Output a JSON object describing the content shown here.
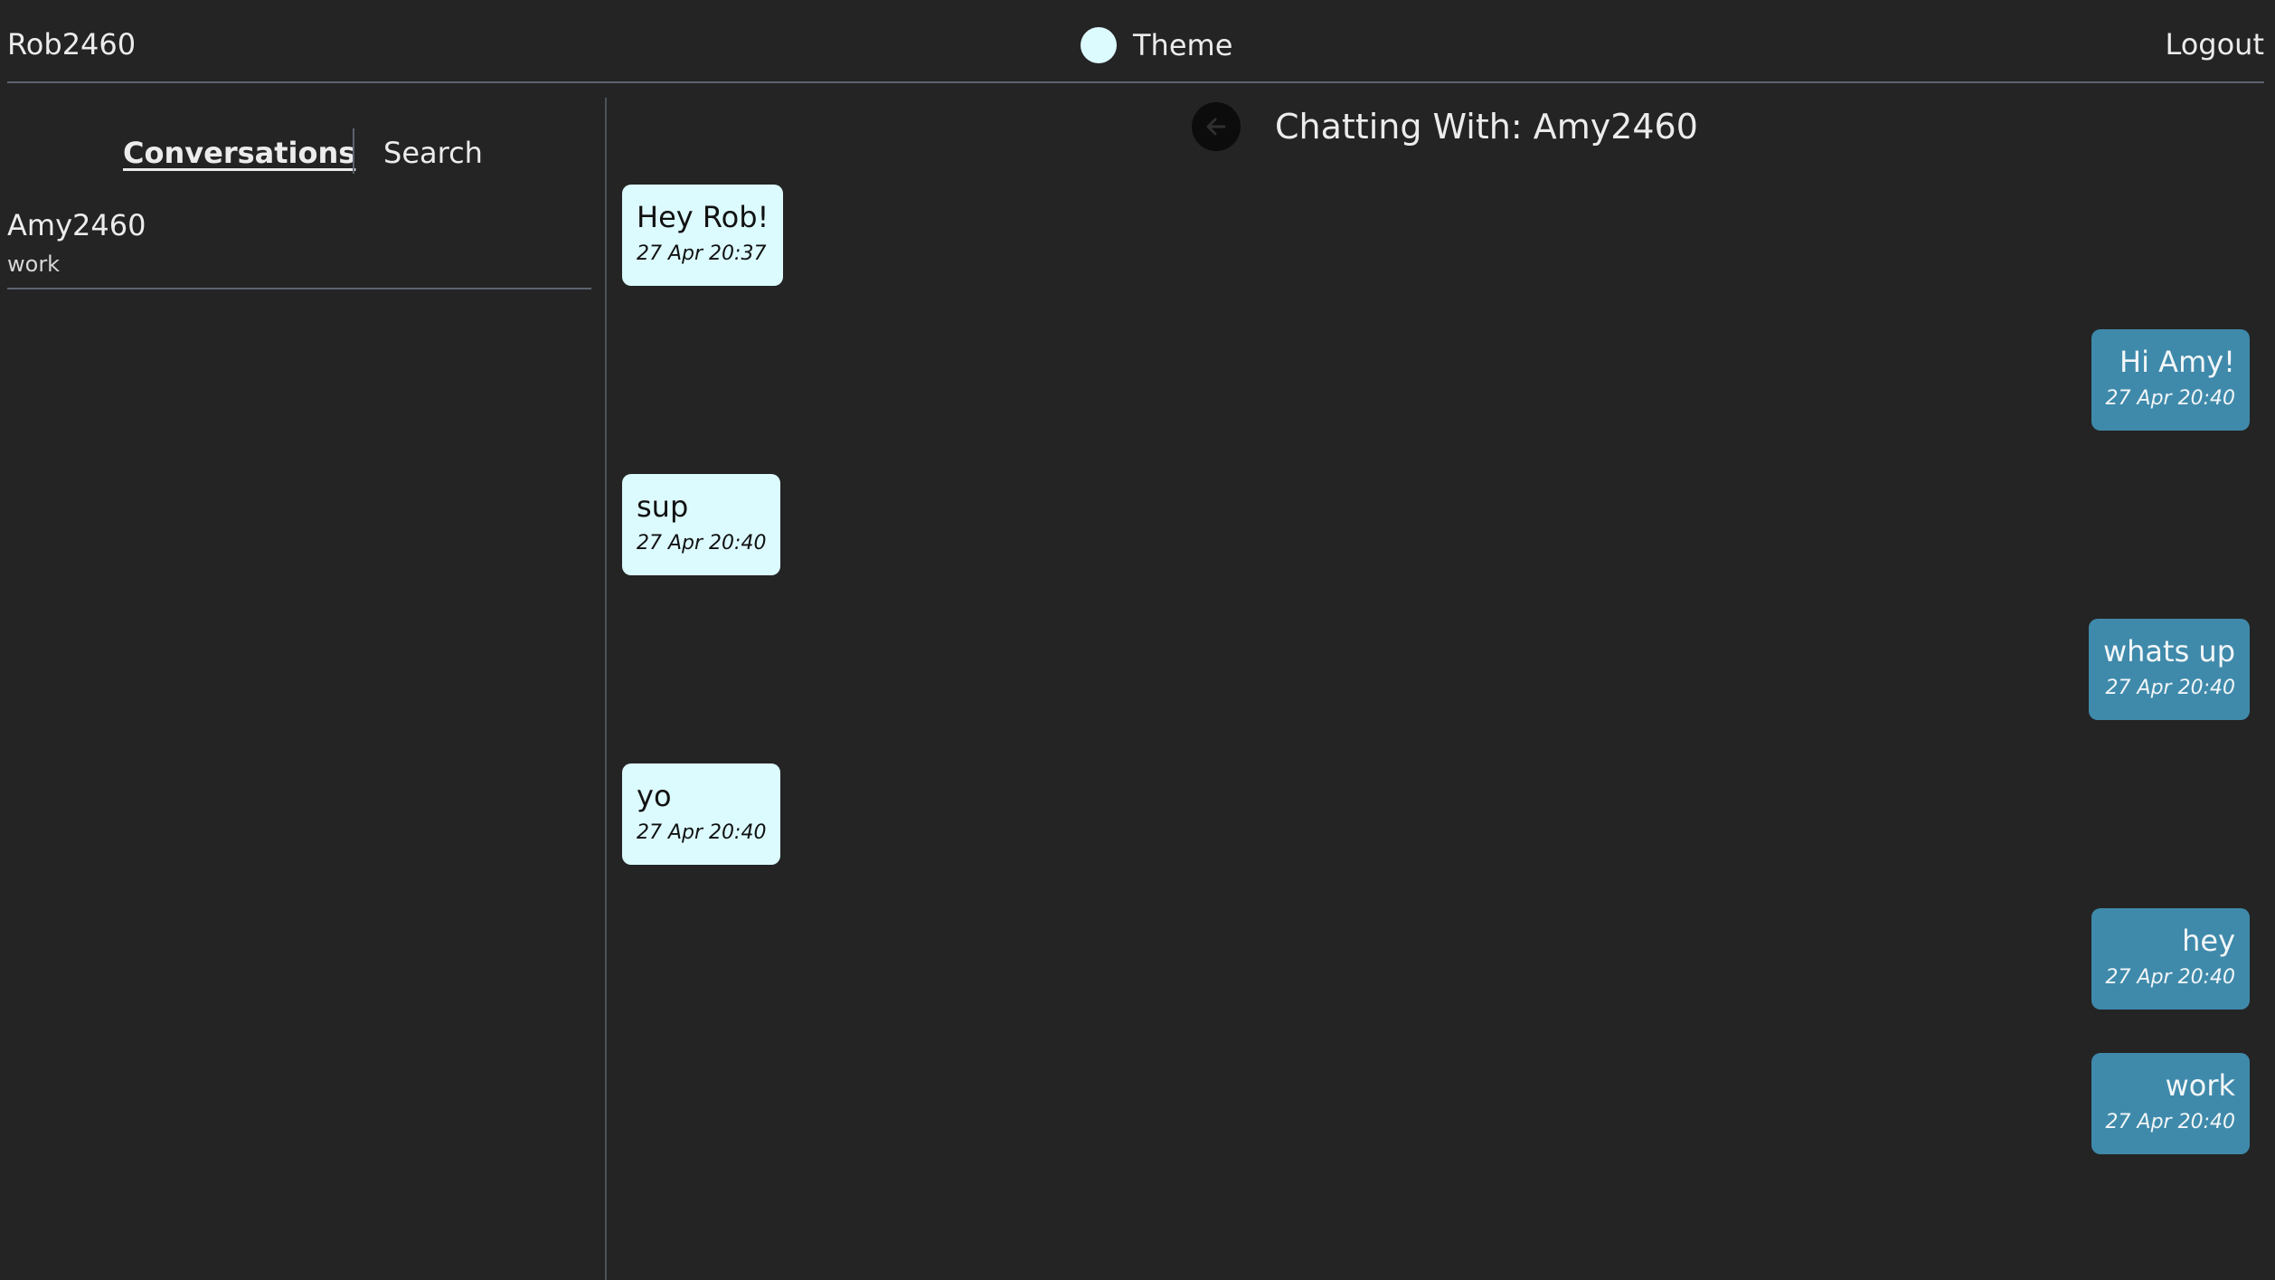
{
  "header": {
    "username": "Rob2460",
    "theme_label": "Theme",
    "logout_label": "Logout"
  },
  "sidebar": {
    "tabs": [
      {
        "label": "Conversations",
        "active": true
      },
      {
        "label": "Search",
        "active": false
      }
    ],
    "conversations": [
      {
        "name": "Amy2460",
        "last_message": "work"
      }
    ]
  },
  "chat": {
    "title": "Chatting With: Amy2460",
    "messages": [
      {
        "direction": "received",
        "text": "Hey Rob!",
        "time": "27 Apr 20:37"
      },
      {
        "direction": "sent",
        "text": "Hi Amy!",
        "time": "27 Apr 20:40"
      },
      {
        "direction": "received",
        "text": "sup",
        "time": "27 Apr 20:40"
      },
      {
        "direction": "sent",
        "text": "whats up",
        "time": "27 Apr 20:40"
      },
      {
        "direction": "received",
        "text": "yo",
        "time": "27 Apr 20:40"
      },
      {
        "direction": "sent",
        "text": "hey",
        "time": "27 Apr 20:40"
      },
      {
        "direction": "sent",
        "text": "work",
        "time": "27 Apr 20:40"
      }
    ]
  },
  "colors": {
    "background": "#242424",
    "received_bubble": "#dcfbff",
    "sent_bubble": "#3f8aab",
    "theme_dot": "#dcfbff",
    "divider": "#5b6470"
  },
  "icons": {
    "back": "arrow-left-icon",
    "theme": "circle-icon"
  }
}
